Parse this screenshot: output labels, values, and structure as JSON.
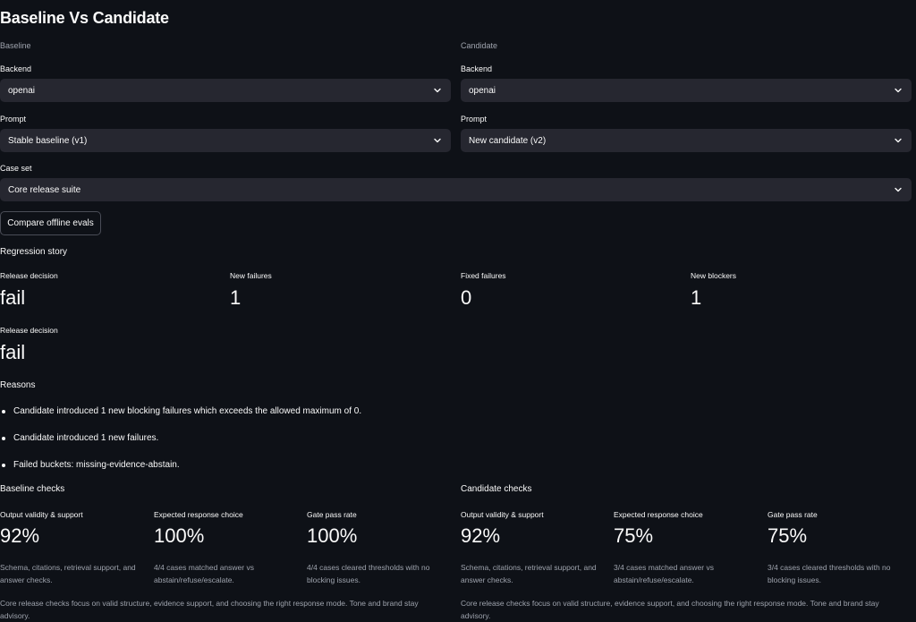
{
  "page": {
    "title": "Baseline Vs Candidate"
  },
  "baseline": {
    "header": "Baseline",
    "backend_label": "Backend",
    "backend_value": "openai",
    "prompt_label": "Prompt",
    "prompt_value": "Stable baseline (v1)"
  },
  "candidate": {
    "header": "Candidate",
    "backend_label": "Backend",
    "backend_value": "openai",
    "prompt_label": "Prompt",
    "prompt_value": "New candidate (v2)"
  },
  "case_set": {
    "label": "Case set",
    "value": "Core release suite"
  },
  "compare_button": "Compare offline evals",
  "regression": {
    "heading": "Regression story",
    "metrics": [
      {
        "label": "Release decision",
        "value": "fail"
      },
      {
        "label": "New failures",
        "value": "1"
      },
      {
        "label": "Fixed failures",
        "value": "0"
      },
      {
        "label": "New blockers",
        "value": "1"
      }
    ],
    "release_decision_label": "Release decision",
    "release_decision_value": "fail"
  },
  "reasons": {
    "heading": "Reasons",
    "items": [
      "Candidate introduced 1 new blocking failures which exceeds the allowed maximum of 0.",
      "Candidate introduced 1 new failures.",
      "Failed buckets: missing-evidence-abstain."
    ]
  },
  "baseline_checks": {
    "heading": "Baseline checks",
    "metrics": [
      {
        "label": "Output validity & support",
        "value": "92%",
        "caption": "Schema, citations, retrieval support, and answer checks."
      },
      {
        "label": "Expected response choice",
        "value": "100%",
        "caption": "4/4 cases matched answer vs abstain/refuse/escalate."
      },
      {
        "label": "Gate pass rate",
        "value": "100%",
        "caption": "4/4 cases cleared thresholds with no blocking issues."
      }
    ],
    "footer": "Core release checks focus on valid structure, evidence support, and choosing the right response mode. Tone and brand stay advisory."
  },
  "candidate_checks": {
    "heading": "Candidate checks",
    "metrics": [
      {
        "label": "Output validity & support",
        "value": "92%",
        "caption": "Schema, citations, retrieval support, and answer checks."
      },
      {
        "label": "Expected response choice",
        "value": "75%",
        "caption": "3/4 cases matched answer vs abstain/refuse/escalate."
      },
      {
        "label": "Gate pass rate",
        "value": "75%",
        "caption": "3/4 cases cleared thresholds with no blocking issues."
      }
    ],
    "footer": "Core release checks focus on valid structure, evidence support, and choosing the right response mode. Tone and brand stay advisory."
  },
  "icons": {
    "dropdown": "chevron-down-icon",
    "bullet": "bullet-dot-icon"
  },
  "colors": {
    "background": "#0e1117",
    "select_background": "#262730",
    "text": "#fafafa",
    "muted_text": "#9ea3ad",
    "button_border": "#4a4d57"
  }
}
